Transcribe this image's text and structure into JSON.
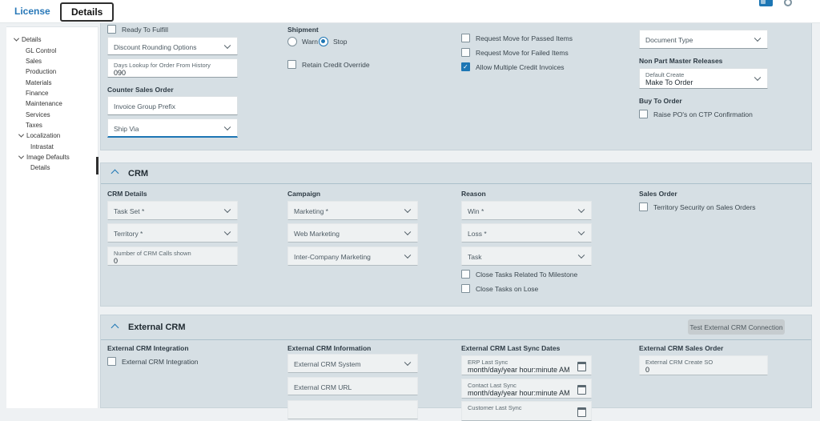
{
  "colors": {
    "accent": "#1d76b4",
    "panel_bg": "#d6dfe4",
    "page_bg": "#eef1f3"
  },
  "topbar": {
    "license_tab": "License",
    "details_tab": "Details"
  },
  "sidebar": {
    "items": [
      "Details",
      "GL Control",
      "Sales",
      "Production",
      "Materials",
      "Finance",
      "Maintenance",
      "Services",
      "Taxes",
      "Localization",
      "Intrastat",
      "Image Defaults",
      "Details"
    ]
  },
  "general": {
    "ready_to_fulfill": "Ready To Fulfill",
    "discount_rounding_options": "Discount Rounding Options",
    "days_lookup": {
      "label": "Days Lookup for Order From History",
      "value": "090"
    },
    "counter_sales_order_header": "Counter Sales Order",
    "invoice_group_prefix": "Invoice Group Prefix",
    "ship_via": "Ship Via",
    "shipment_header": "Shipment",
    "warn": "Warn",
    "stop": "Stop",
    "retain_credit_override": "Retain Credit Override",
    "request_move_passed": "Request Move for Passed Items",
    "request_move_failed": "Request Move for Failed Items",
    "allow_multiple_credit_invoices": "Allow Multiple Credit Invoices",
    "document_type": "Document Type",
    "non_part_master_releases_header": "Non Part Master Releases",
    "default_create": {
      "label": "Default Create",
      "value": "Make To Order"
    },
    "buy_to_order_header": "Buy To Order",
    "raise_pos_on_ctp": "Raise PO's on CTP Confirmation"
  },
  "crm": {
    "section_title": "CRM",
    "crm_details_header": "CRM Details",
    "task_set": "Task Set *",
    "territory": "Territory *",
    "num_calls": {
      "label": "Number of CRM Calls shown",
      "value": "0"
    },
    "campaign_header": "Campaign",
    "marketing": "Marketing *",
    "web_marketing": "Web Marketing",
    "inter_company_marketing": "Inter-Company Marketing",
    "reason_header": "Reason",
    "win": "Win *",
    "loss": "Loss *",
    "task": "Task",
    "close_tasks_milestone": "Close Tasks Related To Milestone",
    "close_tasks_on_lose": "Close Tasks on Lose",
    "sales_order_header": "Sales Order",
    "territory_security": "Territory Security on Sales Orders"
  },
  "external_crm": {
    "section_title": "External CRM",
    "test_connection_button": "Test External CRM Connection",
    "integration_header": "External CRM Integration",
    "integration_checkbox": "External CRM Integration",
    "information_header": "External CRM Information",
    "system": "External CRM System",
    "url": "External CRM URL",
    "sync_dates_header": "External CRM Last Sync Dates",
    "erp_last_sync": {
      "label": "ERP Last Sync",
      "value": "month/day/year hour:minute AM"
    },
    "contact_last_sync": {
      "label": "Contact Last Sync",
      "value": "month/day/year hour:minute AM"
    },
    "customer_last_sync": {
      "label": "Customer Last Sync"
    },
    "sales_order_header": "External CRM Sales Order",
    "create_so": {
      "label": "External CRM Create SO",
      "value": "0"
    }
  }
}
